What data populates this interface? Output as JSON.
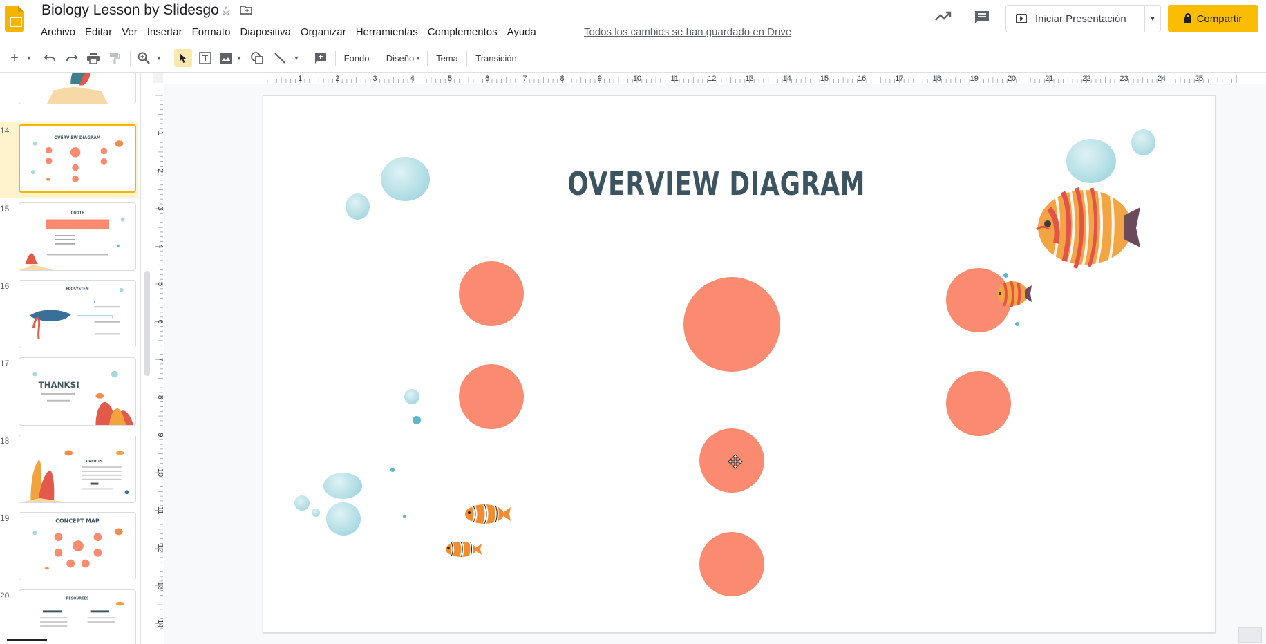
{
  "header": {
    "title": "Biology Lesson by Slidesgo",
    "menu": [
      "Archivo",
      "Editar",
      "Ver",
      "Insertar",
      "Formato",
      "Diapositiva",
      "Organizar",
      "Herramientas",
      "Complementos",
      "Ayuda"
    ],
    "save_status": "Todos los cambios se han guardado en Drive",
    "present_label": "Iniciar Presentación",
    "share_label": "Compartir"
  },
  "toolbar": {
    "background_label": "Fondo",
    "layout_label": "Diseño",
    "theme_label": "Tema",
    "transition_label": "Transición"
  },
  "filmstrip": {
    "slides": [
      {
        "number": "14",
        "title": "OVERVIEW DIAGRAM",
        "selected": true
      },
      {
        "number": "15",
        "title": "QUOTE"
      },
      {
        "number": "16",
        "title": "ECOSYSTEM"
      },
      {
        "number": "17",
        "title": "THANKS!"
      },
      {
        "number": "18",
        "title": "CREDITS"
      },
      {
        "number": "19",
        "title": "CONCEPT MAP"
      },
      {
        "number": "20",
        "title": "RESOURCES"
      }
    ]
  },
  "rulers": {
    "horizontal": [
      "1",
      "2",
      "3",
      "4",
      "5",
      "6",
      "7",
      "8",
      "9",
      "10",
      "11",
      "12",
      "13",
      "14",
      "15",
      "16",
      "17",
      "18",
      "19",
      "20",
      "21",
      "22",
      "23",
      "24",
      "25"
    ],
    "vertical": [
      "1",
      "2",
      "3",
      "4",
      "5",
      "6",
      "7",
      "8",
      "9",
      "10",
      "11",
      "12",
      "13",
      "14"
    ]
  },
  "slide": {
    "title": "OVERVIEW DIAGRAM"
  },
  "colors": {
    "accent_yellow": "#fbbc04",
    "node_coral": "#fa8a70",
    "title_slate": "#3c5460",
    "bubble_teal": "#a5d8e0"
  }
}
